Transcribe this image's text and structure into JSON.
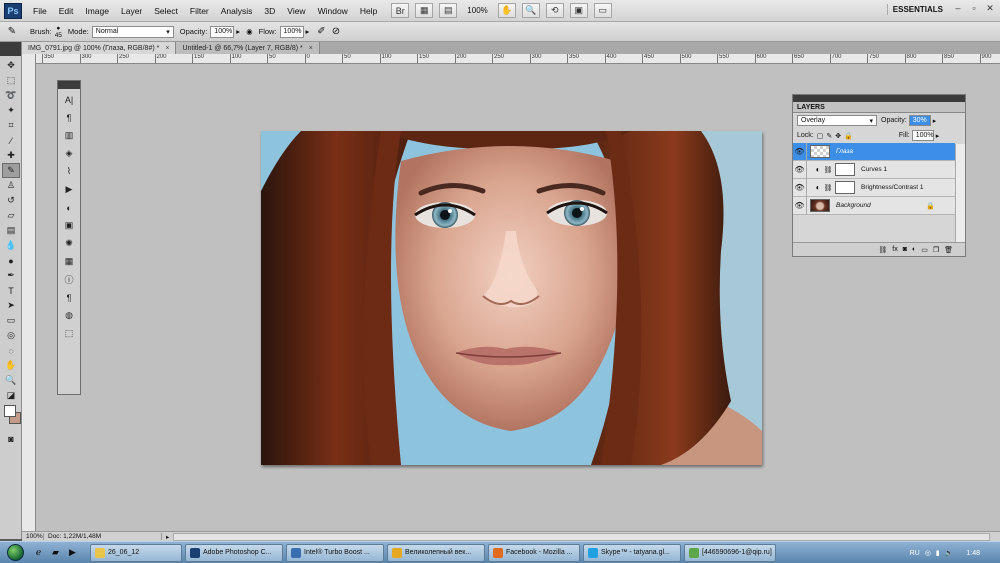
{
  "menubar": {
    "logo": "Ps",
    "items": [
      "File",
      "Edit",
      "Image",
      "Layer",
      "Select",
      "Filter",
      "Analysis",
      "3D",
      "View",
      "Window",
      "Help"
    ],
    "zoom": "100%",
    "workspace": "ESSENTIALS",
    "window_controls": [
      "–",
      "▫",
      "✕"
    ]
  },
  "options": {
    "brush_label": "Brush:",
    "brush_size": "45",
    "mode_label": "Mode:",
    "mode_value": "Normal",
    "opacity_label": "Opacity:",
    "opacity_value": "100%",
    "flow_label": "Flow:",
    "flow_value": "100%"
  },
  "tabs": [
    {
      "label": "IMG_0791.jpg @ 100% (Глаза, RGB/8#) *",
      "close": "×"
    },
    {
      "label": "Untitled-1 @ 66,7% (Layer 7, RGB/8) *",
      "close": "×"
    }
  ],
  "ruler": {
    "marks": [
      "350",
      "300",
      "250",
      "200",
      "150",
      "100",
      "50",
      "0",
      "50",
      "100",
      "150",
      "200",
      "250",
      "300",
      "350",
      "400",
      "450",
      "500",
      "550",
      "600",
      "650",
      "700",
      "750",
      "800",
      "850",
      "900"
    ]
  },
  "layers_panel": {
    "title": "LAYERS",
    "blend_mode": "Overlay",
    "opacity_label": "Opacity:",
    "opacity_value": "30%",
    "lock_label": "Lock:",
    "fill_label": "Fill:",
    "fill_value": "100%",
    "layers": [
      {
        "name": "Глаза",
        "type": "pixel"
      },
      {
        "name": "Curves 1",
        "type": "adjustment"
      },
      {
        "name": "Brightness/Contrast 1",
        "type": "adjustment"
      },
      {
        "name": "Background",
        "type": "background"
      }
    ]
  },
  "status": {
    "zoom": "100%",
    "doc": "Doc: 1,22M/1,48M"
  },
  "taskbar": {
    "tasks": [
      {
        "label": "26_06_12",
        "color": "#e8c44a"
      },
      {
        "label": "Adobe Photoshop C...",
        "color": "#1b3f73"
      },
      {
        "label": "Intel® Turbo Boost ...",
        "color": "#3a6fb0"
      },
      {
        "label": "Великолепный век...",
        "color": "#e5a823"
      },
      {
        "label": "Facebook - Mozilla ...",
        "color": "#e06b1d"
      },
      {
        "label": "Skype™ - tatyana.gl...",
        "color": "#1fa0e0"
      },
      {
        "label": "[446590696-1@qip.ru]",
        "color": "#5ea64a"
      }
    ],
    "lang": "RU",
    "clock": "1:48"
  },
  "colors": {
    "selection_blue": "#3d8ee6",
    "canvas_bg": "#c0c0c0"
  }
}
